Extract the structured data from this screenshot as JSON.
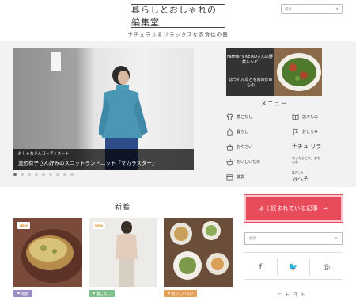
{
  "header": {
    "logo": "暮らしとおしゃれの編集室",
    "tagline": "ナチュラル＆リラックスな衣食住の器",
    "search_placeholder": "検索"
  },
  "hero": {
    "caption_small": "おしゃれさんコーディネート",
    "caption_main": "渡辺有子さん好みのスコットランドニット「マカラスター」",
    "slide_count": 9,
    "active_slide": 1
  },
  "promo": {
    "top_text": "Farmer's KEIKOさんの野菜レシピ",
    "bottom_text": "ほうれん草とを肉の炒めもの"
  },
  "menu": {
    "title": "メニュー",
    "left": [
      {
        "label": "着こなし",
        "icon": "shirt-icon"
      },
      {
        "label": "暮らし",
        "icon": "house-icon"
      },
      {
        "label": "おやさい",
        "icon": "basket-icon"
      },
      {
        "label": "おいしいもの",
        "icon": "bowl-icon"
      },
      {
        "label": "雑貨",
        "icon": "box-icon"
      }
    ],
    "right": [
      {
        "label": "読みもの",
        "icon": "book-icon"
      },
      {
        "label": "おしらせ",
        "icon": "flag-icon"
      },
      {
        "label": "ナチュ リラ",
        "icon": "",
        "style": "big"
      },
      {
        "label": "だったらこれ、おたいれ",
        "icon": "",
        "style": "small"
      },
      {
        "label": "おへそ",
        "icon": "",
        "style": "big",
        "small_prefix": "暮らしの"
      }
    ]
  },
  "new_section": {
    "title": "新着",
    "tag_label": "NEW",
    "cards": [
      {
        "category": "雑貨",
        "cat_color": "#9b8cc6",
        "image": "bread-photo"
      },
      {
        "category": "着こなし",
        "cat_color": "#7fbf8e",
        "image": "fashion-photo"
      },
      {
        "category": "おいしいもの",
        "cat_color": "#e59f59",
        "image": "food-photo"
      }
    ]
  },
  "sidebar": {
    "popular_label": "よく読まれている記事",
    "search_placeholder": "検索",
    "social": [
      {
        "name": "facebook-icon",
        "glyph": "f"
      },
      {
        "name": "twitter-icon",
        "glyph": "🐦"
      },
      {
        "name": "instagram-icon",
        "glyph": "◎"
      }
    ],
    "cut_text": "ヒ ト 日 ト"
  },
  "colors": {
    "band": "#f2f2f2",
    "popular": "#e84c5a",
    "tag": "#e08a1a"
  }
}
